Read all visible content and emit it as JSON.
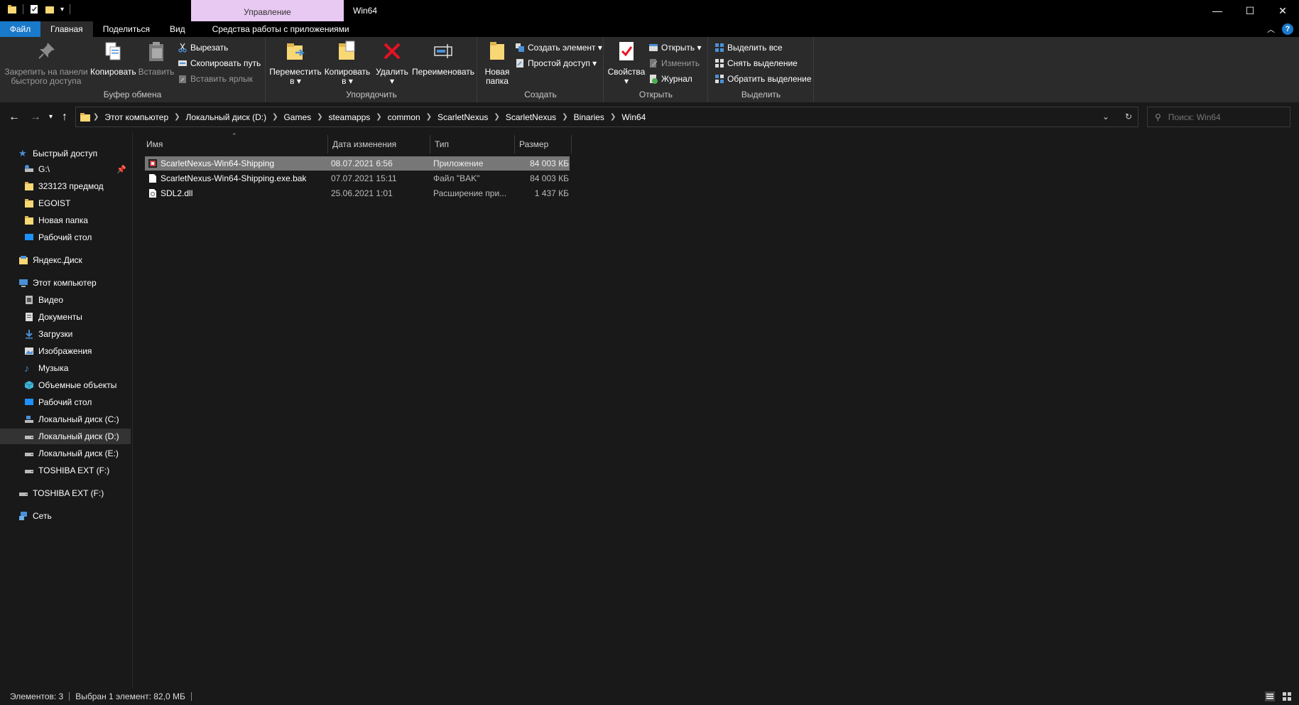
{
  "titlebar": {
    "context_tab": "Управление",
    "window_title": "Win64"
  },
  "ribbon_tabs": {
    "file": "Файл",
    "home": "Главная",
    "share": "Поделиться",
    "view": "Вид",
    "app_tools": "Средства работы с приложениями"
  },
  "ribbon": {
    "clipboard": {
      "label": "Буфер обмена",
      "pin_line1": "Закрепить на панели",
      "pin_line2": "быстрого доступа",
      "copy": "Копировать",
      "paste": "Вставить",
      "cut": "Вырезать",
      "copy_path": "Скопировать путь",
      "paste_shortcut": "Вставить ярлык"
    },
    "organize": {
      "label": "Упорядочить",
      "move_line1": "Переместить",
      "move_line2": "в ▾",
      "copy_line1": "Копировать",
      "copy_line2": "в ▾",
      "delete_line1": "Удалить",
      "delete_line2": "▾",
      "rename": "Переименовать"
    },
    "create": {
      "label": "Создать",
      "new_folder_line1": "Новая",
      "new_folder_line2": "папка",
      "new_item": "Создать элемент ▾",
      "easy_access": "Простой доступ ▾"
    },
    "open": {
      "label": "Открыть",
      "properties_line1": "Свойства",
      "properties_line2": "▾",
      "open": "Открыть ▾",
      "edit": "Изменить",
      "history": "Журнал"
    },
    "select": {
      "label": "Выделить",
      "select_all": "Выделить все",
      "select_none": "Снять выделение",
      "invert": "Обратить выделение"
    }
  },
  "address": {
    "crumbs": [
      "Этот компьютер",
      "Локальный диск (D:)",
      "Games",
      "steamapps",
      "common",
      "ScarletNexus",
      "ScarletNexus",
      "Binaries",
      "Win64"
    ],
    "search_placeholder": "Поиск: Win64"
  },
  "navpane": {
    "quick_access": "Быстрый доступ",
    "items_quick": [
      "G:\\",
      "323123 предмод",
      "EGOIST",
      "Новая папка",
      "Рабочий стол"
    ],
    "yandex": "Яндекс.Диск",
    "this_pc": "Этот компьютер",
    "items_pc": [
      "Видео",
      "Документы",
      "Загрузки",
      "Изображения",
      "Музыка",
      "Объемные объекты",
      "Рабочий стол",
      "Локальный диск (C:)",
      "Локальный диск (D:)",
      "Локальный диск (E:)",
      "TOSHIBA EXT (F:)"
    ],
    "toshiba": "TOSHIBA EXT (F:)",
    "network": "Сеть"
  },
  "columns": {
    "name": "Имя",
    "date": "Дата изменения",
    "type": "Тип",
    "size": "Размер"
  },
  "files": [
    {
      "name": "ScarletNexus-Win64-Shipping",
      "date": "08.07.2021 6:56",
      "type": "Приложение",
      "size": "84 003 КБ"
    },
    {
      "name": "ScarletNexus-Win64-Shipping.exe.bak",
      "date": "07.07.2021 15:11",
      "type": "Файл \"BAK\"",
      "size": "84 003 КБ"
    },
    {
      "name": "SDL2.dll",
      "date": "25.06.2021 1:01",
      "type": "Расширение при...",
      "size": "1 437 КБ"
    }
  ],
  "status": {
    "items": "Элементов: 3",
    "selected": "Выбран 1 элемент: 82,0 МБ"
  },
  "colors": {
    "accent": "#1979ca",
    "context_tab": "#e8c9f2",
    "folder": "#f8d775",
    "selected_row": "#777777"
  }
}
